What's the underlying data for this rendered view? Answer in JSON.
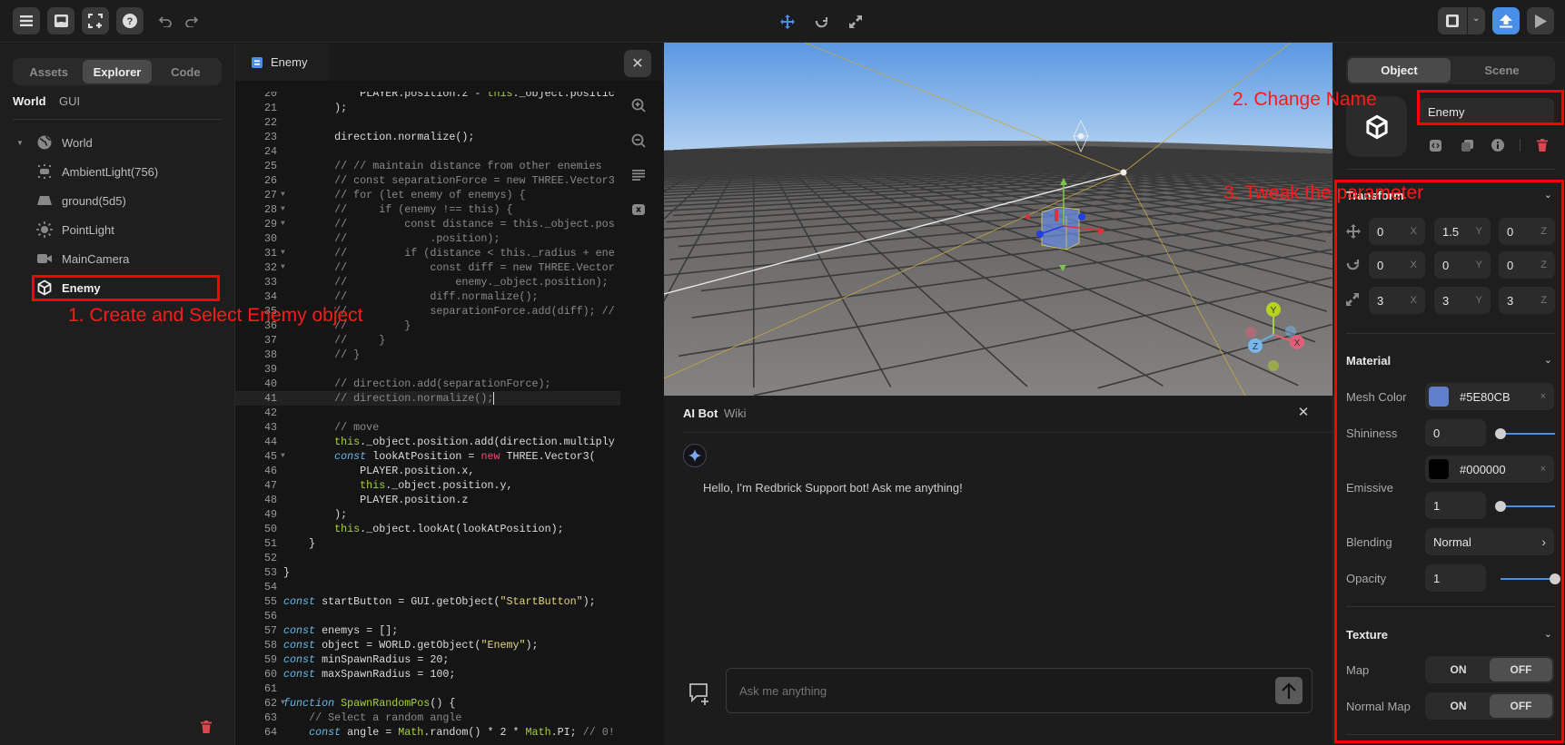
{
  "topbar": {
    "left_icons": [
      "menu-icon",
      "inbox-icon",
      "fullscreen-add-icon",
      "help-icon",
      "undo-icon",
      "redo-icon"
    ],
    "center_icons": [
      "move-icon",
      "rotate-icon",
      "scale-icon"
    ],
    "right_icons": [
      "layout-icon",
      "chevron-down-icon",
      "publish-icon",
      "play-icon"
    ],
    "accent": "#4A8FE7"
  },
  "left": {
    "tabs": [
      {
        "label": "Assets"
      },
      {
        "label": "Explorer",
        "active": true
      },
      {
        "label": "Code"
      }
    ],
    "subtabs": [
      {
        "label": "World",
        "active": true
      },
      {
        "label": "GUI"
      }
    ],
    "tree": [
      {
        "label": "World",
        "icon": "globe-icon"
      },
      {
        "label": "AmbientLight(756)",
        "icon": "ambient-light-icon"
      },
      {
        "label": "ground(5d5)",
        "icon": "ground-icon"
      },
      {
        "label": "PointLight",
        "icon": "sun-icon"
      },
      {
        "label": "MainCamera",
        "icon": "camera-icon"
      },
      {
        "label": "Enemy",
        "icon": "cube-icon",
        "selected": true
      }
    ]
  },
  "editor": {
    "tab": "Enemy",
    "first_line": 20,
    "current_line": 41,
    "fold_lines": [
      27,
      28,
      29,
      31,
      32,
      45,
      62
    ],
    "lines": [
      "            PLAYER.position.z - this._object.positic",
      "        );",
      "",
      "        direction.normalize();",
      "",
      "        // // maintain distance from other enemies",
      "        // const separationForce = new THREE.Vector3",
      "        // for (let enemy of enemys) {",
      "        //     if (enemy !== this) {",
      "        //         const distance = this._object.pos",
      "        //             .position);",
      "        //         if (distance < this._radius + ene",
      "        //             const diff = new THREE.Vector",
      "        //                 enemy._object.position);",
      "        //             diff.normalize();",
      "        //             separationForce.add(diff); //",
      "        //         }",
      "        //     }",
      "        // }",
      "",
      "        // direction.add(separationForce);",
      "        // direction.normalize();",
      "",
      "        // move",
      "        this._object.position.add(direction.multiply",
      "        const lookAtPosition = new THREE.Vector3(",
      "            PLAYER.position.x,",
      "            this._object.position.y,",
      "            PLAYER.position.z",
      "        );",
      "        this._object.lookAt(lookAtPosition);",
      "    }",
      "",
      "}",
      "",
      "const startButton = GUI.getObject(\"StartButton\");",
      "",
      "const enemys = [];",
      "const object = WORLD.getObject(\"Enemy\");",
      "const minSpawnRadius = 20;",
      "const maxSpawnRadius = 100;",
      "",
      "function SpawnRandomPos() {",
      "    // Select a random angle",
      "    const angle = Math.random() * 2 * Math.PI; // 0!"
    ]
  },
  "bot": {
    "tabs": [
      {
        "label": "AI Bot",
        "active": true
      },
      {
        "label": "Wiki"
      }
    ],
    "message": "Hello, I'm Redbrick Support bot! Ask me anything!",
    "input_placeholder": "Ask me anything"
  },
  "gizmo": {
    "y": "Y",
    "x": "X",
    "z": "Z"
  },
  "right": {
    "tabs": [
      {
        "label": "Object",
        "active": true
      },
      {
        "label": "Scene"
      }
    ],
    "name_value": "Enemy",
    "transform": {
      "title": "Transform",
      "rows": [
        {
          "icon": "move-icon",
          "values": [
            "0",
            "1.5",
            "0"
          ]
        },
        {
          "icon": "rotate-icon",
          "values": [
            "0",
            "0",
            "0"
          ]
        },
        {
          "icon": "scale-icon",
          "values": [
            "3",
            "3",
            "3"
          ]
        }
      ],
      "axes": [
        "X",
        "Y",
        "Z"
      ]
    },
    "material": {
      "title": "Material",
      "mesh_color_label": "Mesh Color",
      "mesh_color": "#5E80CB",
      "shininess_label": "Shininess",
      "shininess": "0",
      "shininess_level": 0,
      "emissive_label": "Emissive",
      "emissive_color": "#000000",
      "emissive_intensity": "1",
      "emissive_level": 0,
      "blending_label": "Blending",
      "blending": "Normal",
      "opacity_label": "Opacity",
      "opacity": "1",
      "opacity_level": 1
    },
    "texture": {
      "title": "Texture",
      "map_label": "Map",
      "normal_map_label": "Normal Map",
      "on": "ON",
      "off": "OFF",
      "map": "OFF",
      "normal_map": "OFF"
    }
  },
  "annotations": {
    "step1": "1. Create and Select Enemy object",
    "step2": "2. Change Name",
    "step3": "3. Tweak the parameter",
    "color": "#FF0000"
  }
}
